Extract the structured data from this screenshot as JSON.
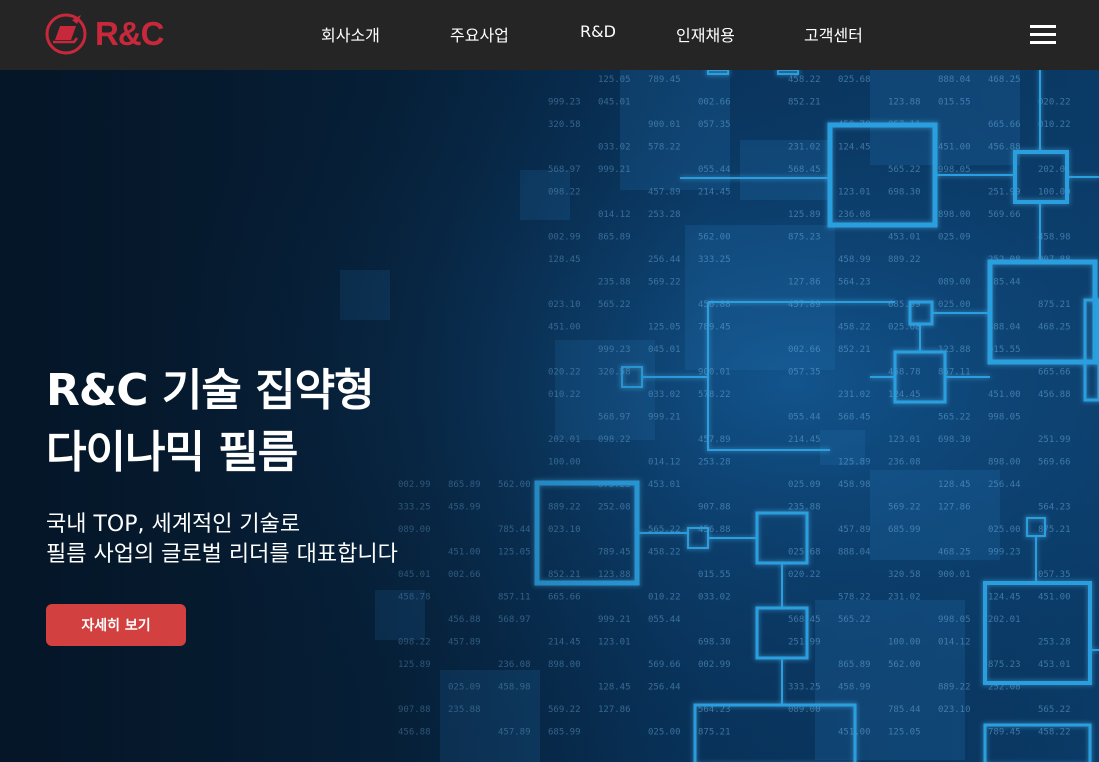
{
  "header": {
    "logo_text": "R&C",
    "nav": [
      {
        "label": "회사소개"
      },
      {
        "label": "주요사업"
      },
      {
        "label": "R&D"
      },
      {
        "label": "인재채용"
      },
      {
        "label": "고객센터"
      }
    ]
  },
  "hero": {
    "headline": [
      "R&C 기술 집약형",
      "다이나믹 필름"
    ],
    "subline": [
      "국내 TOP, 세계적인 기술로",
      "필름 사업의 글로벌 리더를 대표합니다"
    ],
    "cta_label": "자세히 보기"
  },
  "background_numbers": [
    "125.05",
    "789.45",
    "458.22",
    "025.68",
    "888.04",
    "468.25",
    "999.23",
    "045.01",
    "002.66",
    "852.21",
    "123.88",
    "015.55",
    "020.22",
    "320.58",
    "900.01",
    "057.35",
    "458.78",
    "857.11",
    "665.66",
    "010.22",
    "033.02",
    "578.22",
    "231.02",
    "124.45",
    "451.00",
    "456.88",
    "568.97",
    "999.21",
    "055.44",
    "568.45",
    "565.22",
    "998.05",
    "202.01",
    "098.22",
    "457.89",
    "214.45",
    "123.01",
    "698.30",
    "251.99",
    "100.00",
    "014.12",
    "253.28",
    "125.89",
    "236.08",
    "898.00",
    "569.66",
    "002.99",
    "865.89",
    "562.00",
    "875.23",
    "453.01",
    "025.09",
    "458.98",
    "128.45",
    "256.44",
    "333.25",
    "458.99",
    "889.22",
    "252.08",
    "907.88",
    "235.88",
    "569.22",
    "127.86",
    "564.23",
    "089.00",
    "785.44",
    "023.10",
    "565.22",
    "456.88",
    "457.89",
    "685.99",
    "025.00",
    "875.21",
    "451.00"
  ],
  "colors": {
    "header_bg": "#252525",
    "brand": "#c8283c",
    "cta_bg": "#d2403f",
    "accent_line": "#2a9fe0"
  }
}
